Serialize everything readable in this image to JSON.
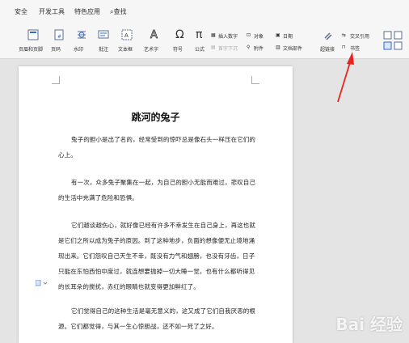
{
  "menu": {
    "items": [
      "安全",
      "开发工具",
      "特色应用"
    ],
    "search_label": "查找"
  },
  "ribbon": {
    "header_footer": "页眉和页脚",
    "page_number": "页码",
    "watermark": "水印",
    "comment": "批注",
    "textbox": "文本框",
    "wordart": "艺术字",
    "symbol": "符号",
    "formula": "公式",
    "insert_number": "插入数字",
    "object": "对象",
    "date": "日期",
    "first_letter_sink": "首字下沉",
    "attachment": "附件",
    "doc_parts": "文档部件",
    "hyperlink": "超链接",
    "cross_reference": "交叉引用",
    "bookmark": "书签"
  },
  "document": {
    "title": "跳河的兔子",
    "p1": "兔子的胆小是出了名的，经常受到的惊吓总是像石头一样压在它们的心上。",
    "p2": "有一次，众多兔子聚集在一起，为自己的胆小无能而难过，悲叹自己的生活中充满了危险和恐惧。",
    "p3": "它们越谈越伤心，就好像已经有许多不幸发生在自己身上，再这也就是它们之所以成为兔子的原因。到了这种地步，负面的想像便无止境地涌现出来。它们怨叹自己天生不幸，既没有力气和翅膀，也没有牙齿，日子只能在东怕西怕中度过，就连想要抛掉一切大睡一觉，也有什么都听得见的长耳朵的搅扰，赤红的眼睛也就变得更加鲜红了。",
    "p4": "它们觉得自己的这种生活是毫无意义的，这又成了它们自我厌恶的根源。它们都觉得，与其一生心惊胆战，还不如一死了之好。"
  },
  "watermark_text": "Bai 经验",
  "colors": {
    "arrow": "#e8231f",
    "accent": "#2f6bd6"
  }
}
